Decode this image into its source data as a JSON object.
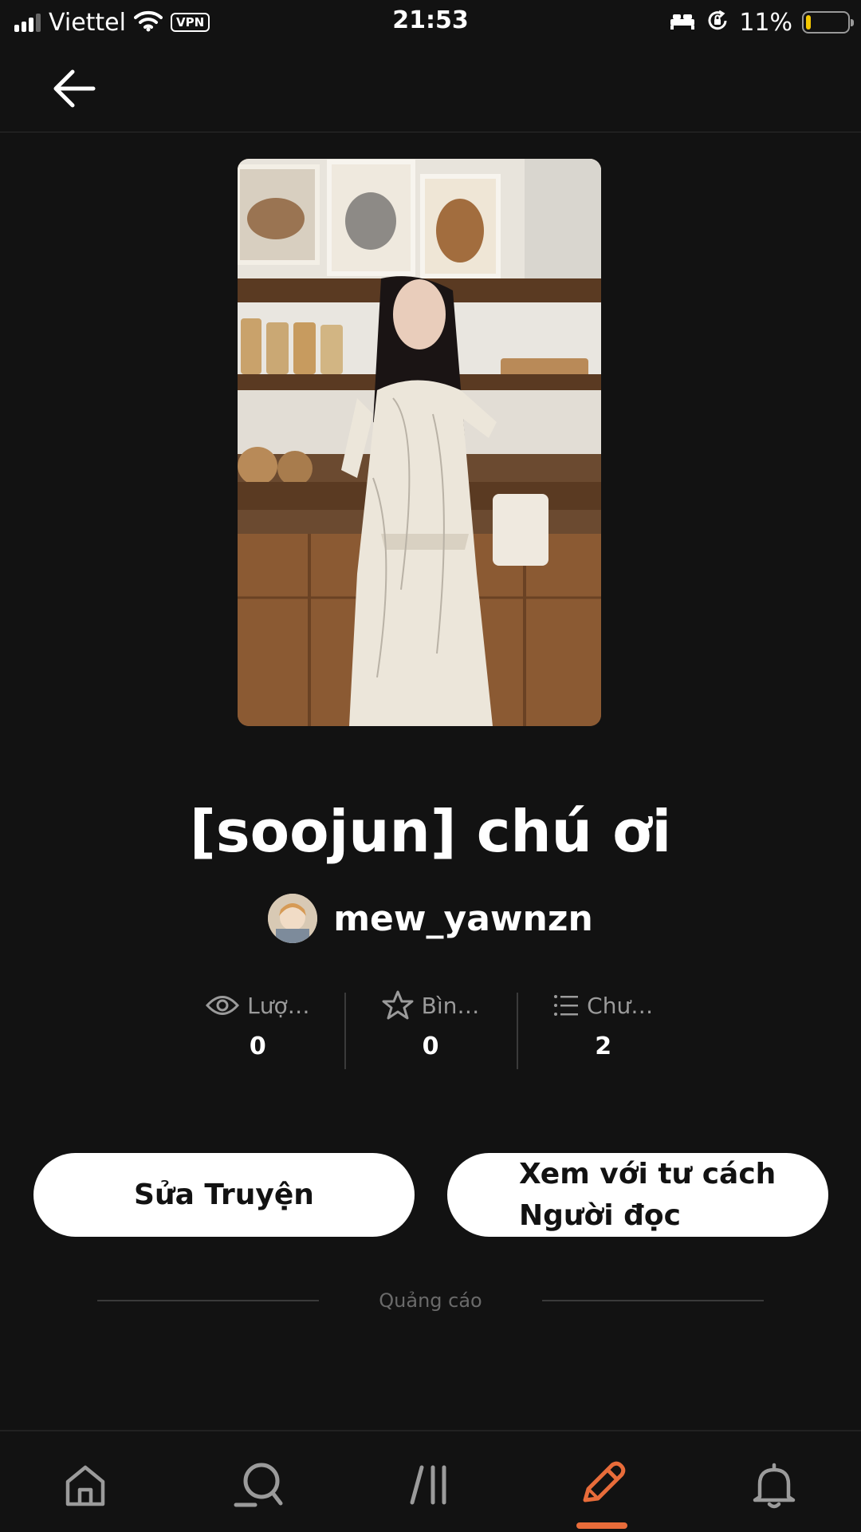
{
  "status_bar": {
    "carrier": "Viettel",
    "vpn": "VPN",
    "time": "21:53",
    "battery_percent": "11%",
    "battery_level": 0.11
  },
  "header": {
    "back_icon": "arrow-left-icon"
  },
  "story": {
    "title": "[soojun] chú ơi",
    "author": "mew_yawnzn"
  },
  "stats": [
    {
      "icon": "eye-icon",
      "label": "Lượ…",
      "value": "0"
    },
    {
      "icon": "star-icon",
      "label": "Bìn…",
      "value": "0"
    },
    {
      "icon": "list-icon",
      "label": "Chư…",
      "value": "2"
    }
  ],
  "actions": {
    "edit_label": "Sửa Truyện",
    "reader_label_line1": "Xem với tư cách",
    "reader_label_line2": "Người đọc"
  },
  "ad": {
    "label": "Quảng cáo"
  },
  "bottom_nav": {
    "items": [
      "home-icon",
      "search-icon",
      "library-icon",
      "write-icon",
      "bell-icon"
    ],
    "active": "write-icon",
    "accent": "#e86c3a"
  }
}
